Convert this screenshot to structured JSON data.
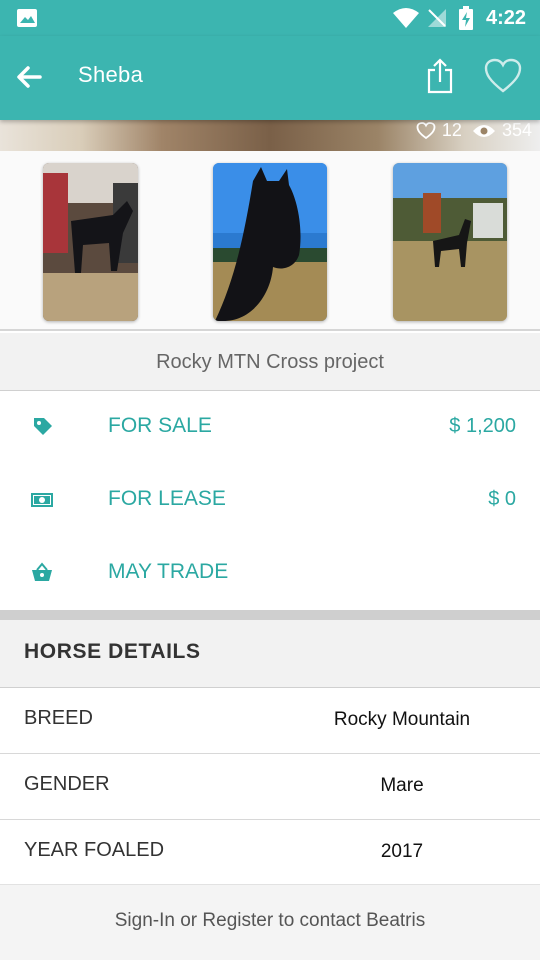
{
  "status_bar": {
    "time": "4:22",
    "icons": [
      "image-icon",
      "wifi-icon",
      "no-signal-icon",
      "battery-charging-icon"
    ]
  },
  "app_bar": {
    "title": "Sheba",
    "back_icon": "arrow-left-icon",
    "share_icon": "share-icon",
    "favorite_icon": "heart-outline-icon"
  },
  "hero": {
    "likes": "12",
    "views": "354"
  },
  "gallery": {
    "thumbnails": [
      "horse-in-barn",
      "horse-closeup",
      "horse-in-field"
    ]
  },
  "description": "Rocky MTN Cross project",
  "pricing": [
    {
      "icon": "tag-icon",
      "label": "FOR SALE",
      "value": "$ 1,200"
    },
    {
      "icon": "cash-icon",
      "label": "FOR LEASE",
      "value": "$ 0"
    },
    {
      "icon": "basket-icon",
      "label": "MAY TRADE",
      "value": ""
    }
  ],
  "details": {
    "header": "HORSE DETAILS",
    "rows": [
      {
        "key": "BREED",
        "value": "Rocky Mountain"
      },
      {
        "key": "GENDER",
        "value": "Mare"
      },
      {
        "key": "YEAR FOALED",
        "value": "2017"
      }
    ]
  },
  "footer": {
    "contact_text": "Sign-In or Register to contact Beatris"
  },
  "colors": {
    "primary": "#3cb5b0",
    "accent_text": "#2ba8a2"
  }
}
